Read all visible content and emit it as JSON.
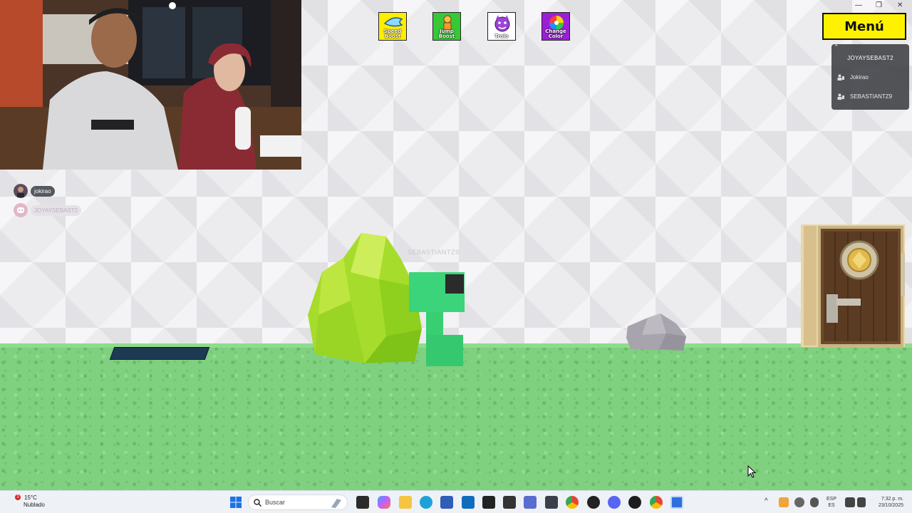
{
  "boosts": [
    {
      "label": "Speed Boost",
      "color": "#ffee00",
      "icon": "wing-icon"
    },
    {
      "label": "Jump Boost",
      "color": "#37c837",
      "icon": "jumper-icon"
    },
    {
      "label": "Trolo",
      "color": "#ffffff",
      "icon": "devil-icon"
    },
    {
      "label": "Change Color",
      "color": "#9b1fd6",
      "icon": "color-wheel-icon"
    }
  ],
  "menu": {
    "label": "Menú"
  },
  "players_panel": {
    "current_player": "JOYAYSEBAST2",
    "players": [
      "Jokirao",
      "SEBASTIANTZ9"
    ]
  },
  "scene": {
    "player_nametag": "SEBASTIANTZ9"
  },
  "voice": [
    {
      "name": "jokirao"
    },
    {
      "name": "JOYAYSEBAST2"
    }
  ],
  "taskbar": {
    "weather_temp": "15°C",
    "weather_desc": "Nublado",
    "weather_badge": "3",
    "search_placeholder": "Buscar",
    "lang_top": "ESP",
    "lang_bottom": "ES",
    "time": "7:32 p. m.",
    "date": "23/10/2025"
  },
  "colors": {
    "menu_bg": "#fff200",
    "grass": "#7fd07f",
    "player": "#3bd47a"
  }
}
